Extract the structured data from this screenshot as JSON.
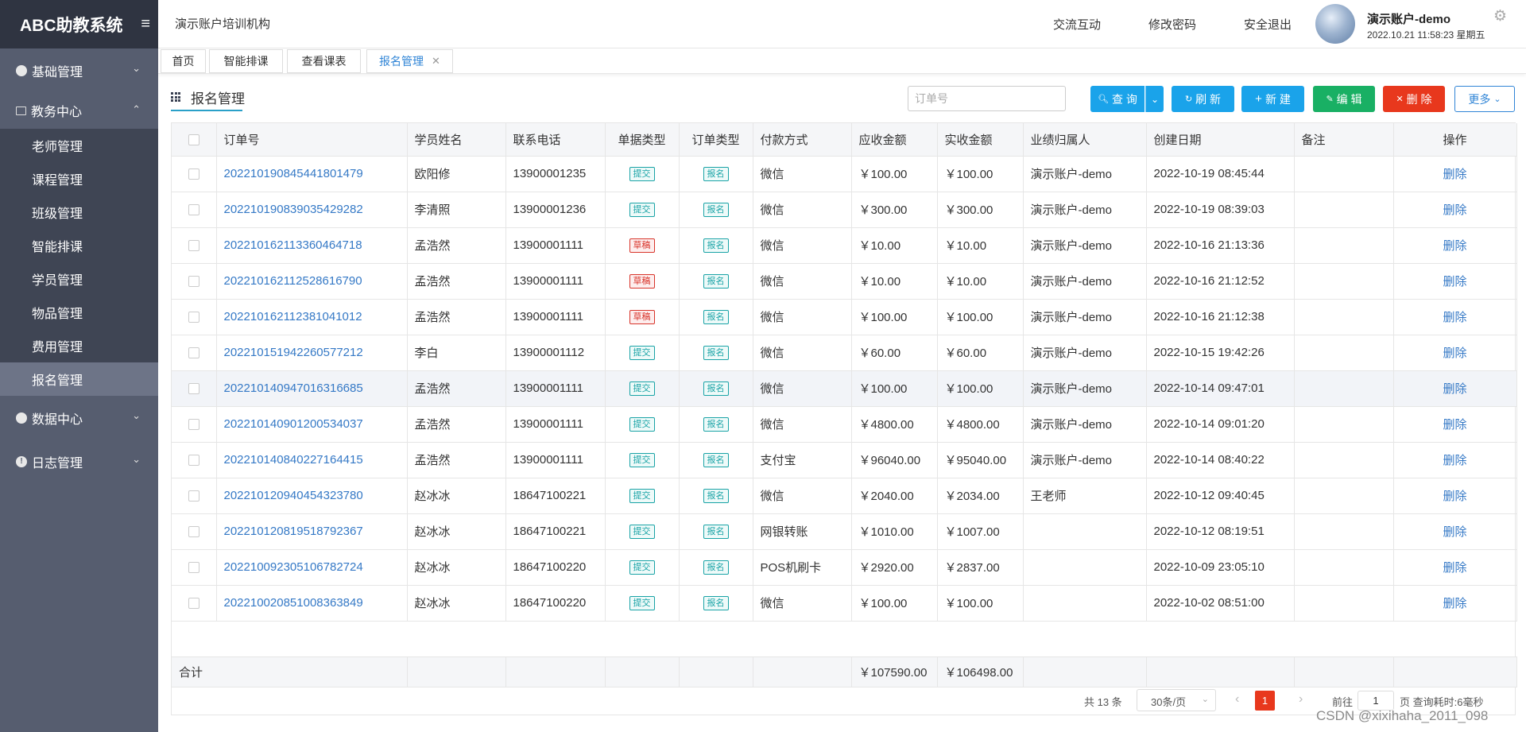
{
  "sidebar": {
    "brand": "ABC助教系统",
    "toggle_icon": "≡",
    "groups": [
      {
        "label": "基础管理"
      },
      {
        "label": "教务中心"
      },
      {
        "label": "数据中心"
      },
      {
        "label": "日志管理"
      }
    ],
    "items": [
      {
        "label": "老师管理"
      },
      {
        "label": "课程管理"
      },
      {
        "label": "班级管理"
      },
      {
        "label": "智能排课"
      },
      {
        "label": "学员管理"
      },
      {
        "label": "物品管理"
      },
      {
        "label": "费用管理"
      },
      {
        "label": "报名管理"
      }
    ]
  },
  "header": {
    "org": "演示账户培训机构",
    "nav": [
      "交流互动",
      "修改密码",
      "安全退出"
    ],
    "user_name": "演示账户-demo",
    "user_time": "2022.10.21 11:58:23 星期五"
  },
  "tabs": [
    {
      "label": "首页"
    },
    {
      "label": "智能排课"
    },
    {
      "label": "查看课表"
    },
    {
      "label": "报名管理"
    }
  ],
  "page": {
    "title": "报名管理",
    "search_placeholder": "订单号",
    "buttons": {
      "query": "查 询",
      "refresh": "刷 新",
      "new": "新 建",
      "edit": "编 辑",
      "delete": "删 除",
      "more": "更多"
    }
  },
  "table": {
    "columns": [
      "订单号",
      "学员姓名",
      "联系电话",
      "单据类型",
      "订单类型",
      "付款方式",
      "应收金额",
      "实收金额",
      "业绩归属人",
      "创建日期",
      "备注",
      "操作"
    ],
    "rows": [
      {
        "order": "20221019084544180 1479",
        "name": "欧阳修",
        "phone": "13900001235",
        "doc": "提交",
        "type": "报名",
        "pay": "微信",
        "due": "￥100.00",
        "paid": "￥100.00",
        "owner": "演示账户-demo",
        "date": "2022-10-19 08:45:44",
        "note": "",
        "op": "删除"
      },
      {
        "order": "202210190839035429282",
        "name": "李清照",
        "phone": "13900001236",
        "doc": "提交",
        "type": "报名",
        "pay": "微信",
        "due": "￥300.00",
        "paid": "￥300.00",
        "owner": "演示账户-demo",
        "date": "2022-10-19 08:39:03",
        "note": "",
        "op": "删除"
      },
      {
        "order": "202210162113360464718",
        "name": "孟浩然",
        "phone": "13900001111",
        "doc": "草稿",
        "type": "报名",
        "pay": "微信",
        "due": "￥10.00",
        "paid": "￥10.00",
        "owner": "演示账户-demo",
        "date": "2022-10-16 21:13:36",
        "note": "",
        "op": "删除"
      },
      {
        "order": "202210162112528616790",
        "name": "孟浩然",
        "phone": "13900001111",
        "doc": "草稿",
        "type": "报名",
        "pay": "微信",
        "due": "￥10.00",
        "paid": "￥10.00",
        "owner": "演示账户-demo",
        "date": "2022-10-16 21:12:52",
        "note": "",
        "op": "删除"
      },
      {
        "order": "202210162112381041012",
        "name": "孟浩然",
        "phone": "13900001111",
        "doc": "草稿",
        "type": "报名",
        "pay": "微信",
        "due": "￥100.00",
        "paid": "￥100.00",
        "owner": "演示账户-demo",
        "date": "2022-10-16 21:12:38",
        "note": "",
        "op": "删除"
      },
      {
        "order": "202210151942260577212",
        "name": "李白",
        "phone": "13900001112",
        "doc": "提交",
        "type": "报名",
        "pay": "微信",
        "due": "￥60.00",
        "paid": "￥60.00",
        "owner": "演示账户-demo",
        "date": "2022-10-15 19:42:26",
        "note": "",
        "op": "删除"
      },
      {
        "order": "202210140947016316685",
        "name": "孟浩然",
        "phone": "13900001111",
        "doc": "提交",
        "type": "报名",
        "pay": "微信",
        "due": "￥100.00",
        "paid": "￥100.00",
        "owner": "演示账户-demo",
        "date": "2022-10-14 09:47:01",
        "note": "",
        "op": "删除"
      },
      {
        "order": "202210140901200534037",
        "name": "孟浩然",
        "phone": "13900001111",
        "doc": "提交",
        "type": "报名",
        "pay": "微信",
        "due": "￥4800.00",
        "paid": "￥4800.00",
        "owner": "演示账户-demo",
        "date": "2022-10-14 09:01:20",
        "note": "",
        "op": "删除"
      },
      {
        "order": "202210140840227164415",
        "name": "孟浩然",
        "phone": "13900001111",
        "doc": "提交",
        "type": "报名",
        "pay": "支付宝",
        "due": "￥96040.00",
        "paid": "￥95040.00",
        "owner": "演示账户-demo",
        "date": "2022-10-14 08:40:22",
        "note": "",
        "op": "删除"
      },
      {
        "order": "202210120940454323780",
        "name": "赵冰冰",
        "phone": "18647100221",
        "doc": "提交",
        "type": "报名",
        "pay": "微信",
        "due": "￥2040.00",
        "paid": "￥2034.00",
        "owner": "王老师",
        "date": "2022-10-12 09:40:45",
        "note": "",
        "op": "删除"
      },
      {
        "order": "202210120819518792367",
        "name": "赵冰冰",
        "phone": "18647100221",
        "doc": "提交",
        "type": "报名",
        "pay": "网银转账",
        "due": "￥1010.00",
        "paid": "￥1007.00",
        "owner": "",
        "date": "2022-10-12 08:19:51",
        "note": "",
        "op": "删除"
      },
      {
        "order": "202210092305106782724",
        "name": "赵冰冰",
        "phone": "18647100220",
        "doc": "提交",
        "type": "报名",
        "pay": "POS机刷卡",
        "due": "￥2920.00",
        "paid": "￥2837.00",
        "owner": "",
        "date": "2022-10-09 23:05:10",
        "note": "",
        "op": "删除"
      },
      {
        "order": "202210020851008363849",
        "name": "赵冰冰",
        "phone": "18647100220",
        "doc": "提交",
        "type": "报名",
        "pay": "微信",
        "due": "￥100.00",
        "paid": "￥100.00",
        "owner": "",
        "date": "2022-10-02 08:51:00",
        "note": "",
        "op": "删除"
      }
    ],
    "summary": {
      "label": "合计",
      "due": "￥107590.00",
      "paid": "￥106498.00"
    }
  },
  "pager": {
    "total": "共 13 条",
    "page_size": "30条/页",
    "current": "1",
    "goto_label": "前往",
    "goto_value": "1",
    "info": "页 查询耗时:6毫秒"
  },
  "watermark": "CSDN @xixihaha_2011_098"
}
